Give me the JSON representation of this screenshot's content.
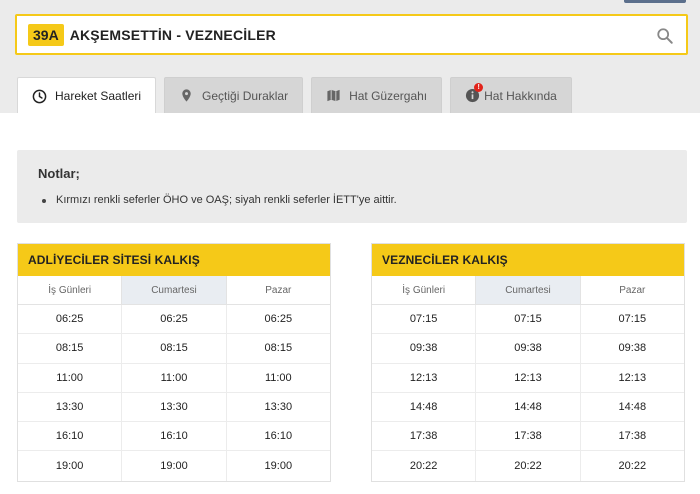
{
  "route": {
    "code": "39A",
    "name": "AKŞEMSETTİN - VEZNECİLER"
  },
  "tabs": [
    {
      "label": "Hareket Saatleri",
      "icon": "clock-icon",
      "active": true
    },
    {
      "label": "Geçtiği Duraklar",
      "icon": "map-pin-icon",
      "active": false
    },
    {
      "label": "Hat Güzergahı",
      "icon": "map-icon",
      "active": false
    },
    {
      "label": "Hat Hakkında",
      "icon": "info-icon",
      "active": false,
      "badge": "!"
    }
  ],
  "notes": {
    "title": "Notlar;",
    "items": [
      "Kırmızı renkli seferler ÖHO ve OAŞ; siyah renkli seferler İETT'ye aittir."
    ]
  },
  "colors": {
    "accent": "#f5c918",
    "badge": "#e2231a",
    "highlight_col": "#e9edf2"
  },
  "schedules": [
    {
      "title": "ADLİYECİLER SİTESİ KALKIŞ",
      "columns": [
        "İş Günleri",
        "Cumartesi",
        "Pazar"
      ],
      "rows": [
        [
          "06:25",
          "06:25",
          "06:25"
        ],
        [
          "08:15",
          "08:15",
          "08:15"
        ],
        [
          "11:00",
          "11:00",
          "11:00"
        ],
        [
          "13:30",
          "13:30",
          "13:30"
        ],
        [
          "16:10",
          "16:10",
          "16:10"
        ],
        [
          "19:00",
          "19:00",
          "19:00"
        ]
      ]
    },
    {
      "title": "VEZNECİLER KALKIŞ",
      "columns": [
        "İş Günleri",
        "Cumartesi",
        "Pazar"
      ],
      "rows": [
        [
          "07:15",
          "07:15",
          "07:15"
        ],
        [
          "09:38",
          "09:38",
          "09:38"
        ],
        [
          "12:13",
          "12:13",
          "12:13"
        ],
        [
          "14:48",
          "14:48",
          "14:48"
        ],
        [
          "17:38",
          "17:38",
          "17:38"
        ],
        [
          "20:22",
          "20:22",
          "20:22"
        ]
      ]
    }
  ]
}
